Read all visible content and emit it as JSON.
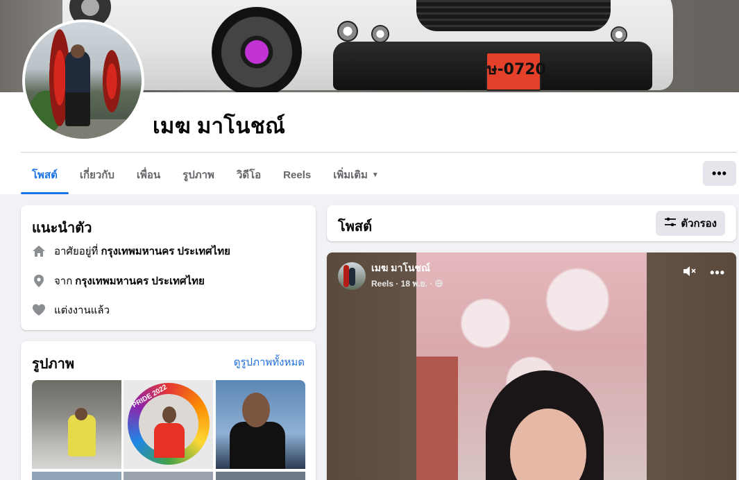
{
  "profile": {
    "name": "เมฆ มาโนชณ์",
    "license_plate": "ษ-0720"
  },
  "tabs": [
    {
      "label": "โพสต์",
      "active": true
    },
    {
      "label": "เกี่ยวกับ"
    },
    {
      "label": "เพื่อน"
    },
    {
      "label": "รูปภาพ"
    },
    {
      "label": "วิดีโอ"
    },
    {
      "label": "Reels"
    },
    {
      "label": "เพิ่มเติม"
    }
  ],
  "more_button": "•••",
  "intro": {
    "title": "แนะนำตัว",
    "lives_prefix": "อาศัยอยู่ที่",
    "lives_value": "กรุงเทพมหานคร ประเทศไทย",
    "from_prefix": "จาก",
    "from_value": "กรุงเทพมหานคร ประเทศไทย",
    "relationship": "แต่งงานแล้ว"
  },
  "photos": {
    "title": "รูปภาพ",
    "see_all": "ดูรูปภาพทั้งหมด",
    "frame_label": "PRIDE 2022"
  },
  "posts": {
    "title": "โพสต์",
    "filter_label": "ตัวกรอง"
  },
  "reel": {
    "author": "เมฆ มาโนชณ์",
    "meta": "Reels · 18 พ.ย. ·",
    "more": "•••"
  },
  "colors": {
    "accent": "#1b74e4",
    "link": "#216fdb",
    "page_bg": "#f0f2f5",
    "button_bg": "#e4e6eb"
  }
}
